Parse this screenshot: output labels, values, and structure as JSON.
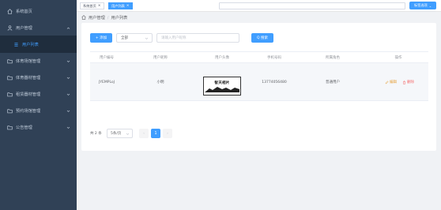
{
  "sidebar": {
    "items": [
      {
        "label": "系统首页",
        "icon": "home-icon"
      },
      {
        "label": "用户管理",
        "icon": "user-icon"
      },
      {
        "label": "用户列表",
        "icon": "list-icon"
      },
      {
        "label": "体育场馆管理",
        "icon": "folder-icon"
      },
      {
        "label": "体育器材管理",
        "icon": "folder-icon"
      },
      {
        "label": "租赁器材管理",
        "icon": "folder-icon"
      },
      {
        "label": "预约场馆管理",
        "icon": "folder-icon"
      },
      {
        "label": "公告管理",
        "icon": "folder-icon"
      }
    ]
  },
  "tags": {
    "home": "系统首页",
    "active": "用户列表",
    "close": "×"
  },
  "top_button": {
    "label": "标签选项",
    "caret": "⌄"
  },
  "breadcrumb": {
    "level1": "用户管理",
    "separator": "/",
    "level2": "用户列表"
  },
  "toolbar": {
    "add_label": "+ 添加",
    "select_value": "全部",
    "search_placeholder": "请输入用户昵称",
    "search_label": "Q 搜索"
  },
  "table": {
    "headers": [
      "用户编号",
      "用户昵称",
      "用户头像",
      "手机号码",
      "所属角色",
      "操作"
    ],
    "rows": [
      {
        "id": "JYEMPLoJ",
        "nickname": "小明",
        "avatar_text": "智天相片",
        "phone": "13774056480",
        "role": "普通用户",
        "edit": "编辑",
        "delete": "删除"
      }
    ]
  },
  "pagination": {
    "total": "共 2 条",
    "page_size": "5条/页",
    "prev": "‹",
    "current": "1",
    "next": "›"
  },
  "colors": {
    "sidebar": "#304156",
    "accent": "#409eff",
    "warning": "#e6a23c",
    "danger": "#f56c6c"
  }
}
